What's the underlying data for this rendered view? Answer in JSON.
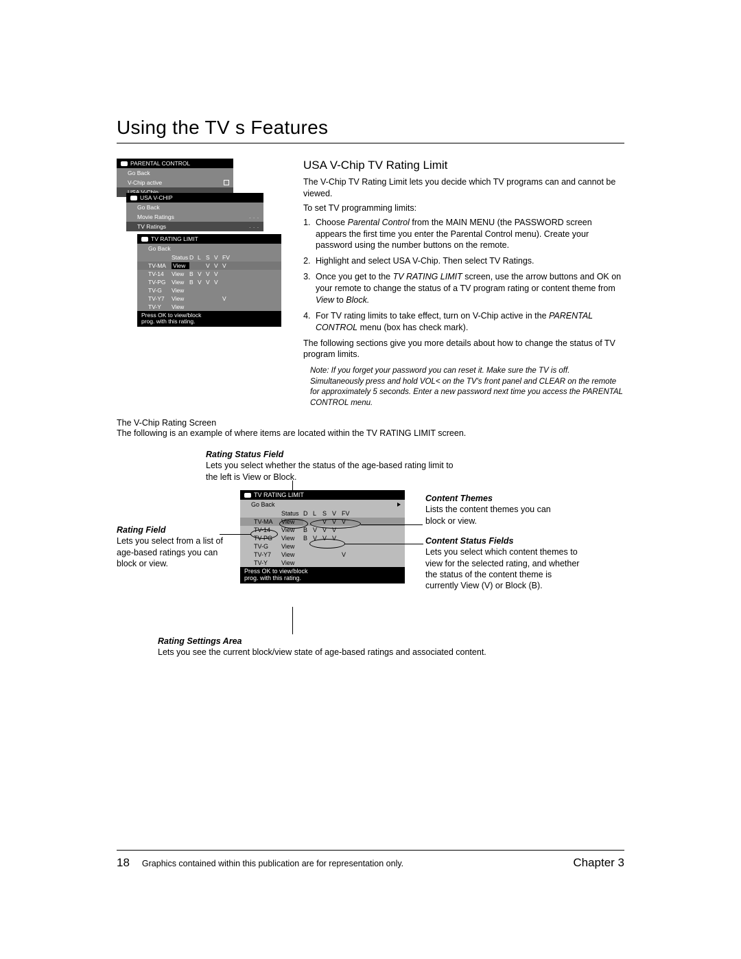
{
  "title": "Using the TV s Features",
  "section_heading": "USA V-Chip TV Rating Limit",
  "intro_p1": "The V-Chip TV Rating Limit lets you decide which TV programs can and cannot be viewed.",
  "intro_p2": "To set TV programming limits:",
  "step1_a": "Choose ",
  "step1_b": "Parental Control",
  "step1_c": " from the MAIN MENU (the PASSWORD screen appears the first time you enter the Parental Control menu). Create your password using the number buttons on the remote.",
  "step2_a": "Highlight and select ",
  "step2_b": "USA V-Chip. ",
  "step2_c": "Then select ",
  "step2_d": "TV Ratings",
  "step3_a": "Once you get to the ",
  "step3_b": "TV RATING LIMIT",
  "step3_c": " screen, use the arrow buttons and OK on your remote to change the status of a TV program rating or content theme from ",
  "step3_d": "View",
  "step3_e": " to ",
  "step3_f": "Block.",
  "step4_a": "For TV rating limits to take effect, turn on ",
  "step4_b": "V-Chip active",
  "step4_c": " in the ",
  "step4_d": "PARENTAL CONTROL",
  "step4_e": " menu (box has check mark).",
  "follow_p": "The following sections give you more details about how to change the status of TV program limits.",
  "note": "Note: If you forget your password you can reset it. Make sure the TV is off. Simultaneously press and hold VOL< on the TV's front panel and CLEAR on the remote for approximately 5 seconds. Enter a new password next time you access the PARENTAL CONTROL menu.",
  "screen_heading": "The V-Chip Rating Screen",
  "screen_p_a": "The following is an example of where items are located within the ",
  "screen_p_b": "TV RATING LIMIT",
  "screen_p_c": " screen.",
  "menu1": {
    "title": "PARENTAL CONTROL",
    "goback": "Go Back",
    "vchip_active": "V-Chip active",
    "usa_vchip": "USA V-Chip",
    "dots": ". . ."
  },
  "menu2": {
    "title": "USA V-CHIP",
    "goback": "Go Back",
    "movie": "Movie Ratings",
    "dots": ". . .",
    "tv": "TV Ratings",
    "dots2": ". . ."
  },
  "menu3": {
    "title": "TV RATING LIMIT",
    "goback": "Go Back",
    "hdr_status": "Status",
    "cols": [
      "D",
      "L",
      "S",
      "V",
      "FV"
    ],
    "rows": [
      {
        "r": "TV-MA",
        "s": "View",
        "v": [
          "",
          "",
          "V",
          "V",
          "V"
        ]
      },
      {
        "r": "TV-14",
        "s": "View",
        "v": [
          "B",
          "V",
          "V",
          "V",
          ""
        ]
      },
      {
        "r": "TV-PG",
        "s": "View",
        "v": [
          "B",
          "V",
          "V",
          "V",
          ""
        ]
      },
      {
        "r": "TV-G",
        "s": "View",
        "v": [
          "",
          "",
          "",
          "",
          ""
        ]
      },
      {
        "r": "TV-Y7",
        "s": "View",
        "v": [
          "",
          "",
          "",
          "",
          "V"
        ]
      },
      {
        "r": "TV-Y",
        "s": "View",
        "v": [
          "",
          "",
          "",
          "",
          ""
        ]
      }
    ],
    "foot1": "Press OK to view/block",
    "foot2": "prog. with this rating."
  },
  "callouts": {
    "rsf_h": "Rating Status Field",
    "rsf_t": "Lets you select whether the status of the age-based rating limit to the left is View or Block.",
    "rf_h": "Rating Field",
    "rf_t": "Lets you select from a list of age-based ratings you can block or view.",
    "ct_h": "Content Themes",
    "ct_t": "Lists the content themes you can block or view.",
    "csf_h": "Content Status Fields",
    "csf_t": "Lets you select which content themes to view for the selected rating, and whether the status of the content theme is currently View (V) or Block (B).",
    "rsa_h": "Rating Settings Area",
    "rsa_t": "Lets you see the current block/view state of age-based ratings and associated content."
  },
  "footer": {
    "page": "18",
    "mid": "Graphics contained within this publication are for representation only.",
    "chapter": "Chapter 3"
  }
}
